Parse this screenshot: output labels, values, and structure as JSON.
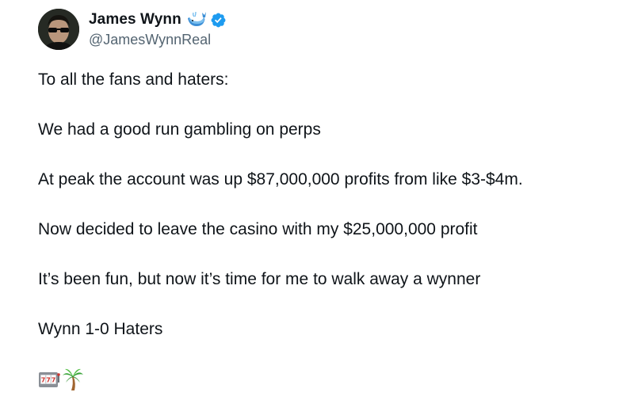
{
  "author": {
    "display_name": "James Wynn",
    "handle": "@JamesWynnReal",
    "badges": [
      "whale-icon",
      "verified-icon"
    ],
    "verified_color": "#1d9bf0"
  },
  "tweet": {
    "lines": [
      "To all the fans and haters:",
      "We had a good run gambling on perps",
      "At peak the account was up $87,000,000 profits from like $3-$4m.",
      "Now decided to leave the casino with my $25,000,000 profit",
      "It’s been fun, but now it’s time for me to walk away a wynner",
      "Wynn 1-0 Haters"
    ],
    "emojis": [
      "slot-machine-icon",
      "palm-tree-icon"
    ]
  }
}
